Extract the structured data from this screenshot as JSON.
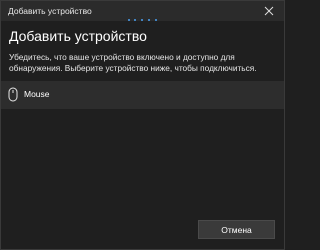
{
  "window": {
    "title": "Добавить устройство"
  },
  "dialog": {
    "heading": "Добавить устройство",
    "description": "Убедитесь, что ваше устройство включено и доступно для обнаружения. Выберите устройство ниже, чтобы подключиться."
  },
  "devices": [
    {
      "label": "Mouse",
      "icon": "mouse-icon"
    }
  ],
  "footer": {
    "cancel_label": "Отмена"
  },
  "colors": {
    "background": "#1f1f1f",
    "titlebar": "#2b2b2b",
    "selected_item": "#2d2d2d",
    "accent": "#4aa0f0",
    "button": "#3a3a3a"
  }
}
